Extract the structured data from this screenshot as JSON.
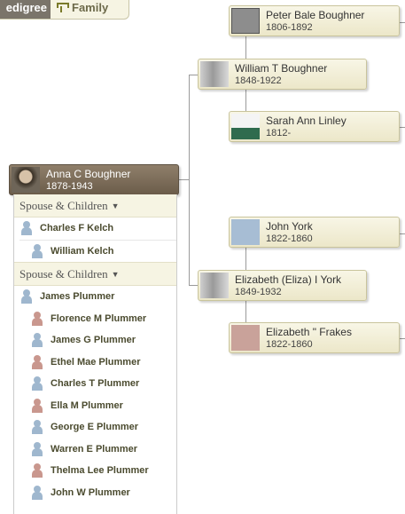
{
  "tabs": {
    "pedigree": "edigree",
    "family": "Family"
  },
  "focus": {
    "name": "Anna C Boughner",
    "dates": "1878-1943"
  },
  "parents": [
    {
      "name": "William T Boughner",
      "dates": "1848-1922"
    },
    {
      "name": "Elizabeth (Eliza) I York",
      "dates": "1849-1932"
    }
  ],
  "grandparents": [
    {
      "name": "Peter Bale Boughner",
      "dates": "1806-1892"
    },
    {
      "name": "Sarah Ann Linley",
      "dates": "1812-"
    },
    {
      "name": "John York",
      "dates": "1822-1860"
    },
    {
      "name": "Elizabeth \" Frakes",
      "dates": "1822-1860"
    }
  ],
  "families": [
    {
      "header": "Spouse & Children",
      "spouse": "Charles F Kelch",
      "children": [
        {
          "name": "William Kelch",
          "gender": "male"
        }
      ]
    },
    {
      "header": "Spouse & Children",
      "spouse": "James Plummer",
      "children": [
        {
          "name": "Florence M Plummer",
          "gender": "female"
        },
        {
          "name": "James G Plummer",
          "gender": "male"
        },
        {
          "name": "Ethel Mae Plummer",
          "gender": "female"
        },
        {
          "name": "Charles T Plummer",
          "gender": "male"
        },
        {
          "name": "Ella M Plummer",
          "gender": "female"
        },
        {
          "name": "George E Plummer",
          "gender": "male"
        },
        {
          "name": "Warren E Plummer",
          "gender": "male"
        },
        {
          "name": "Thelma Lee Plummer",
          "gender": "female"
        },
        {
          "name": "John W Plummer",
          "gender": "male"
        }
      ]
    }
  ],
  "colors": {
    "card_bg": "#f3f0da",
    "focus_bg": "#7c6d59",
    "male_silhouette": "#a7bdd4",
    "female_silhouette": "#c9a29a"
  }
}
